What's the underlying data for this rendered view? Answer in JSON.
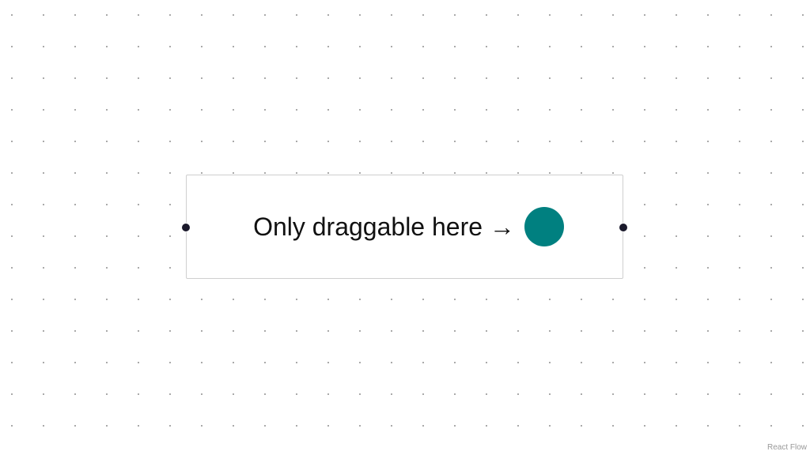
{
  "canvas": {
    "background": "#ffffff",
    "dot_color": "#9a9a9a"
  },
  "node": {
    "label": "Only draggable here →",
    "handle_color": "#008080",
    "border_color": "#cfcfcf",
    "connector_color": "#1a192b"
  },
  "attribution": {
    "text": "React Flow"
  }
}
